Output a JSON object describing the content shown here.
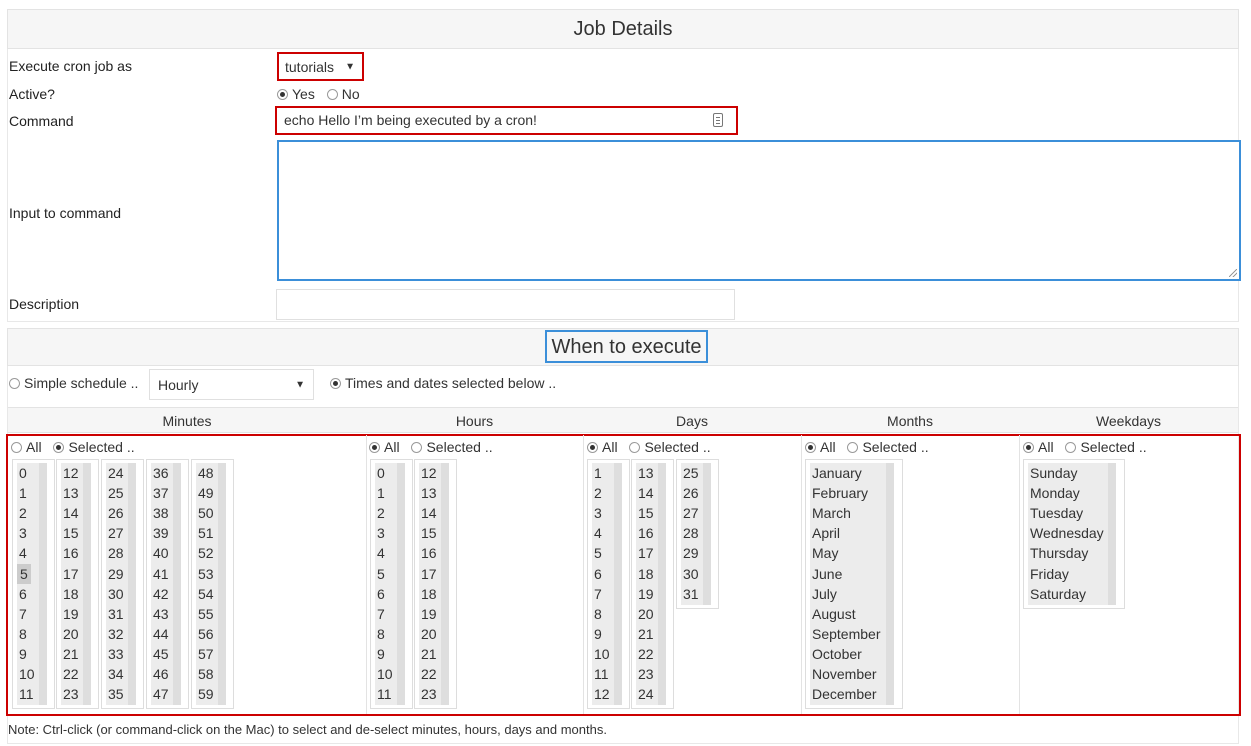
{
  "job_details": {
    "header": "Job Details",
    "execute_label": "Execute cron job as",
    "execute_value": "tutorials",
    "active_label": "Active?",
    "active_yes": "Yes",
    "active_no": "No",
    "command_label": "Command",
    "command_value": "echo Hello I’m being executed by a cron!",
    "input_label": "Input to command",
    "input_value": "",
    "description_label": "Description",
    "description_value": ""
  },
  "when": {
    "header": "When to execute",
    "simple_label": "Simple schedule ..",
    "simple_value": "Hourly",
    "times_label": "Times and dates selected below ..",
    "all_label": "All",
    "selected_label": "Selected ..",
    "columns": {
      "minutes": "Minutes",
      "hours": "Hours",
      "days": "Days",
      "months": "Months",
      "weekdays": "Weekdays"
    },
    "minutes_lists": [
      [
        "0",
        "1",
        "2",
        "3",
        "4",
        "5",
        "6",
        "7",
        "8",
        "9",
        "10",
        "11"
      ],
      [
        "12",
        "13",
        "14",
        "15",
        "16",
        "17",
        "18",
        "19",
        "20",
        "21",
        "22",
        "23"
      ],
      [
        "24",
        "25",
        "26",
        "27",
        "28",
        "29",
        "30",
        "31",
        "32",
        "33",
        "34",
        "35"
      ],
      [
        "36",
        "37",
        "38",
        "39",
        "40",
        "41",
        "42",
        "43",
        "44",
        "45",
        "46",
        "47"
      ],
      [
        "48",
        "49",
        "50",
        "51",
        "52",
        "53",
        "54",
        "55",
        "56",
        "57",
        "58",
        "59"
      ]
    ],
    "minutes_selected": "5",
    "hours_lists": [
      [
        "0",
        "1",
        "2",
        "3",
        "4",
        "5",
        "6",
        "7",
        "8",
        "9",
        "10",
        "11"
      ],
      [
        "12",
        "13",
        "14",
        "15",
        "16",
        "17",
        "18",
        "19",
        "20",
        "21",
        "22",
        "23"
      ]
    ],
    "days_lists": [
      [
        "1",
        "2",
        "3",
        "4",
        "5",
        "6",
        "7",
        "8",
        "9",
        "10",
        "11",
        "12"
      ],
      [
        "13",
        "14",
        "15",
        "16",
        "17",
        "18",
        "19",
        "20",
        "21",
        "22",
        "23",
        "24"
      ],
      [
        "25",
        "26",
        "27",
        "28",
        "29",
        "30",
        "31"
      ]
    ],
    "months_list": [
      "January",
      "February",
      "March",
      "April",
      "May",
      "June",
      "July",
      "August",
      "September",
      "October",
      "November",
      "December"
    ],
    "weekdays_list": [
      "Sunday",
      "Monday",
      "Tuesday",
      "Wednesday",
      "Thursday",
      "Friday",
      "Saturday"
    ]
  },
  "note": "Note: Ctrl-click (or command-click on the Mac) to select and de-select minutes, hours, days and months.",
  "colors": {
    "highlight_red": "#cc0000",
    "highlight_blue": "#3b8fd9",
    "header_bg": "#f6f6f6"
  },
  "icons": {
    "select_arrow": "caret-down-icon",
    "command_picker": "file-picker-icon"
  }
}
